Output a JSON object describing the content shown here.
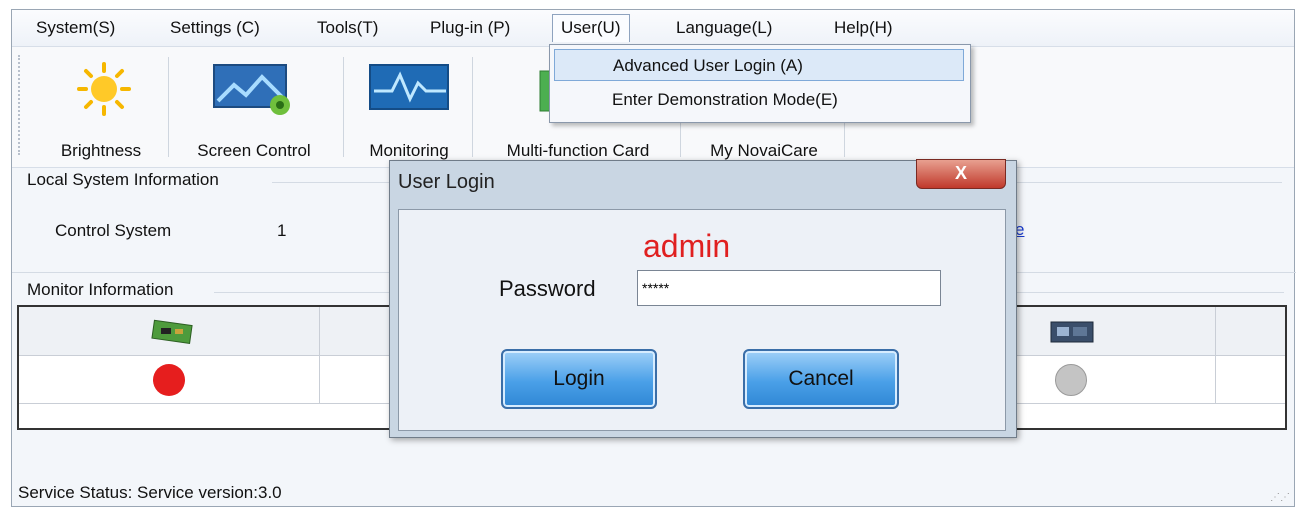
{
  "menu": {
    "items": [
      "System(S)",
      "Settings (C)",
      "Tools(T)",
      "Plug-in (P)",
      "User(U)",
      "Language(L)",
      "Help(H)"
    ]
  },
  "toolbar": {
    "brightness": "Brightness",
    "screen_control": "Screen Control",
    "monitoring": "Monitoring",
    "multifunction_card": "Multi-function Card",
    "my_novaicare": "My NovaiCare"
  },
  "user_menu": {
    "advanced_login": "Advanced User Login (A)",
    "demo_mode": "Enter Demonstration Mode(E)"
  },
  "local_info": {
    "title": "Local System Information",
    "control_system_label": "Control System",
    "control_system_value": "1",
    "link_fragment": "e"
  },
  "monitor": {
    "title": "Monitor Information",
    "left_status_color": "#e61e1e",
    "right_status_color": "#c4c4c4"
  },
  "status": {
    "text": "Service Status:  Service version:3.0"
  },
  "dialog": {
    "title": "User Login",
    "close_glyph": "X",
    "annotation": "admin",
    "password_label": "Password",
    "password_value": "*****",
    "login_label": "Login",
    "cancel_label": "Cancel"
  }
}
